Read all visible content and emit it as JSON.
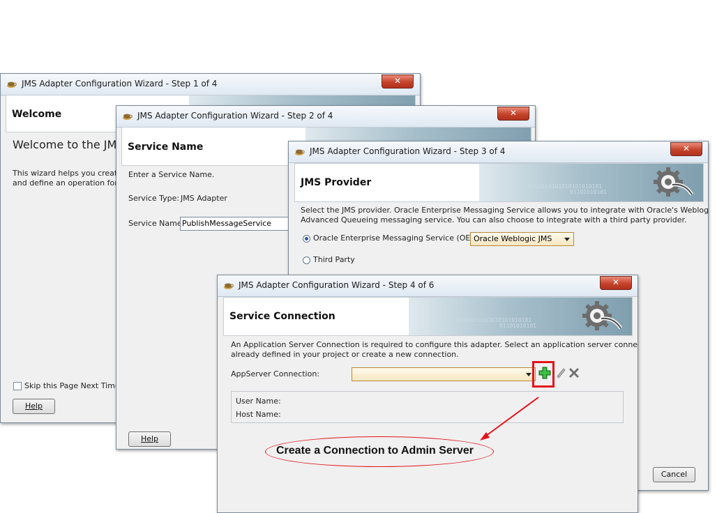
{
  "windows": {
    "step1": {
      "title": "JMS Adapter Configuration Wizard - Step 1 of 4",
      "header": "Welcome",
      "welcome_text": "Welcome to the JMS",
      "desc_line1": "This wizard helps you create a",
      "desc_line2": "and define an operation for the",
      "skip_label": "Skip this Page Next Time",
      "help_label": "Help"
    },
    "step2": {
      "title": "JMS Adapter Configuration Wizard - Step 2 of 4",
      "header": "Service Name",
      "prompt": "Enter a Service Name.",
      "service_type_label": "Service Type:",
      "service_type_value": "JMS Adapter",
      "service_name_label": "Service Name:",
      "service_name_value": "PublishMessageService",
      "help_label": "Help"
    },
    "step3": {
      "title": "JMS Adapter Configuration Wizard - Step 3 of 4",
      "header": "JMS Provider",
      "desc_line1": "Select the JMS provider. Oracle Enterprise Messaging Service allows you to integrate with Oracle's Weblogic or",
      "desc_line2": "Advanced Queueing messaging service. You can also choose to integrate with a third party provider.",
      "oems_label": "Oracle Enterprise Messaging Service (OEMS)",
      "oems_selected": "Oracle Weblogic JMS",
      "third_party_label": "Third Party",
      "cancel_label": "Cancel"
    },
    "step4": {
      "title": "JMS Adapter Configuration Wizard - Step 4 of 6",
      "header": "Service Connection",
      "desc_line1": "An Application Server Connection is required to configure this adapter. Select an application server connection",
      "desc_line2": "already defined in your project or create a new connection.",
      "appserver_label": "AppServer Connection:",
      "appserver_value": "",
      "user_name_label": "User Name:",
      "host_name_label": "Host Name:"
    }
  },
  "banner_binary": "0101010101010101010101",
  "banner_binary2": "01101010101",
  "annotation": {
    "callout_text": "Create a Connection to Admin Server"
  },
  "colors": {
    "annotation_red": "#e3141b",
    "close_red": "#c4432b",
    "add_green": "#22a02a"
  }
}
